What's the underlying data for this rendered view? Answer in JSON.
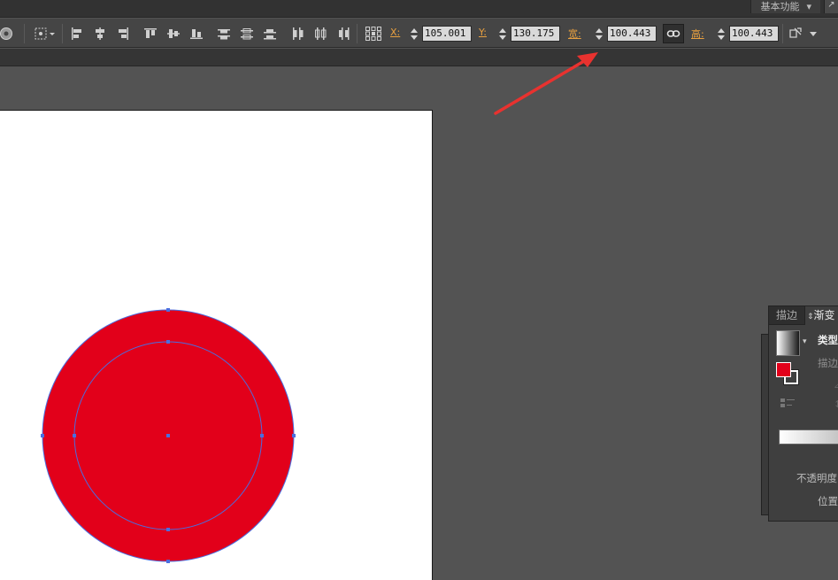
{
  "workspace": {
    "label": "基本功能",
    "arrow": "▾",
    "corner_icon": "expand-corner-icon"
  },
  "controlbar": {
    "x_label": "X:",
    "x_value": "105.001 m",
    "y_label": "Y:",
    "y_value": "130.175 m",
    "w_label": "宽:",
    "w_value": "100.443 m",
    "h_label": "高:",
    "h_value": "100.443 m"
  },
  "gradient_panel": {
    "tab_stroke": "描边",
    "tab_gradient": "渐变",
    "type_label": "类型",
    "stroke_label": "描边",
    "opacity_label": "不透明度",
    "location_label": "位置"
  },
  "canvas": {
    "fill_color": "#e2001a",
    "selection_color": "#4a6ee0",
    "annotation_color": "#e8322f"
  }
}
